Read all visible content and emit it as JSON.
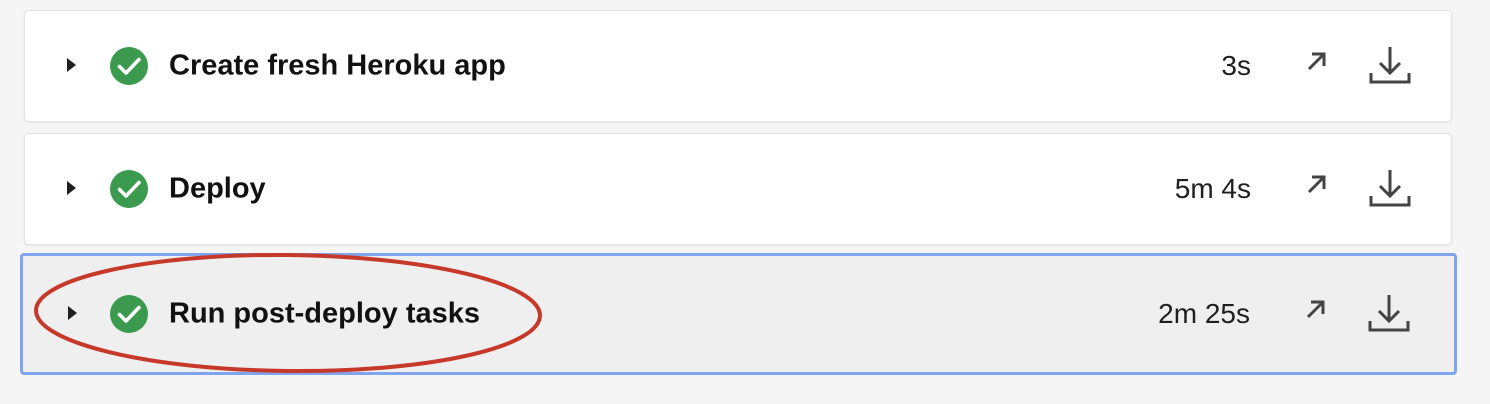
{
  "colors": {
    "success_green": "#3c9a4f",
    "selection_border": "#7fa5ef",
    "annotation_red": "#c6392a"
  },
  "icons": {
    "status": "check-circle-icon",
    "expander": "caret-right-icon",
    "open": "arrow-up-right-icon",
    "download": "download-icon"
  },
  "steps": [
    {
      "title": "Create fresh Heroku app",
      "duration": "3s",
      "status": "success"
    },
    {
      "title": "Deploy",
      "duration": "5m 4s",
      "status": "success"
    },
    {
      "title": "Run post-deploy tasks",
      "duration": "2m 25s",
      "status": "success",
      "selected": true,
      "annotated": true
    }
  ]
}
